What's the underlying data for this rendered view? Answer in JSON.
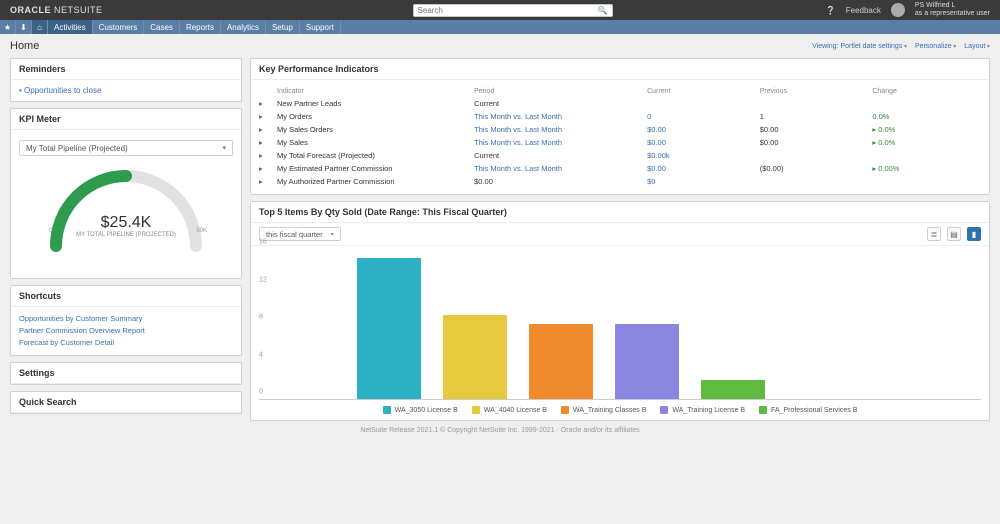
{
  "brand": {
    "vendor": "ORACLE",
    "product": "NETSUITE"
  },
  "search": {
    "placeholder": "Search"
  },
  "topright": {
    "help_label": "Help",
    "feedback_label": "Feedback",
    "user_name": "PS Wilfried L",
    "user_role": "as a representative user"
  },
  "nav": {
    "star_icon": "star-icon",
    "home_icon": "home-icon",
    "items": [
      "Activities",
      "Customers",
      "Cases",
      "Reports",
      "Analytics",
      "Setup",
      "Support"
    ]
  },
  "page": {
    "title": "Home",
    "actions": [
      "Viewing: Portlet date settings",
      "Personalize",
      "Layout"
    ]
  },
  "reminders": {
    "title": "Reminders",
    "items": [
      "Opportunities to close"
    ]
  },
  "kpi_meter": {
    "title": "KPI Meter",
    "selector": "My Total Pipeline (Projected)",
    "value": "$25.4K",
    "subtitle": "MY TOTAL PIPELINE (PROJECTED)",
    "tick_min": "0",
    "tick_max": "50K",
    "percent": 0.5
  },
  "shortcuts": {
    "title": "Shortcuts",
    "items": [
      "Opportunities by Customer Summary",
      "Partner Commission Overview Report",
      "Forecast by Customer Detail"
    ]
  },
  "settings": {
    "title": "Settings"
  },
  "quick_search": {
    "title": "Quick Search"
  },
  "kpi": {
    "title": "Key Performance Indicators",
    "columns": [
      "",
      "Indicator",
      "Period",
      "Current",
      "Previous",
      "Change"
    ],
    "rows": [
      {
        "indicator": "New Partner Leads",
        "period": "Current",
        "current": "",
        "previous": "",
        "change": ""
      },
      {
        "indicator": "My Orders",
        "period": "This Month vs. Last Month",
        "period_link": true,
        "current": "0",
        "previous": "1",
        "change": "0.0%"
      },
      {
        "indicator": "My Sales Orders",
        "period": "This Month vs. Last Month",
        "period_link": true,
        "current": "$0.00",
        "previous": "$0.00",
        "change": "▸ 0.0%"
      },
      {
        "indicator": "My Sales",
        "period": "This Month vs. Last Month",
        "period_link": true,
        "current": "$0.00",
        "previous": "$0.00",
        "change": "▸ 0.0%"
      },
      {
        "indicator": "My Total Forecast (Projected)",
        "period": "Current",
        "current": "$0.00k",
        "previous": "",
        "change": ""
      },
      {
        "indicator": "My Estimated Partner Commission",
        "period": "This Month vs. Last Month",
        "period_link": true,
        "current": "$0.00",
        "previous": "($0.00)",
        "change": "▸ 0.00%"
      },
      {
        "indicator": "My Authorized Partner Commission",
        "period": "$0.00",
        "current": "$0",
        "previous": "",
        "change": ""
      }
    ]
  },
  "top_items_title": "Top 5 Items By Qty Sold (Date Range: This Fiscal Quarter)",
  "top_items_selector": "this fiscal quarter",
  "chart_toolbar_icons": [
    "list-icon",
    "bar-icon",
    "settings-icon"
  ],
  "chart_data": {
    "type": "bar",
    "title": "Top 5 Items By Qty Sold (Date Range: This Fiscal Quarter)",
    "ylabel": "",
    "ylim": [
      0,
      16
    ],
    "yticks": [
      0,
      4,
      8,
      12,
      16
    ],
    "categories": [
      "WA_3050 License B",
      "WA_4040 License B",
      "WA_Training Classes B",
      "WA_Training License B",
      "FA_Professional Services B"
    ],
    "values": [
      15,
      9,
      8,
      8,
      2
    ],
    "colors": [
      "#2db2c5",
      "#e7c93d",
      "#ef8a2e",
      "#8b86e0",
      "#5fba3f"
    ]
  },
  "footer": "NetSuite Release 2021.1   © Copyright NetSuite Inc. 1999-2021 · Oracle and/or its affiliates"
}
